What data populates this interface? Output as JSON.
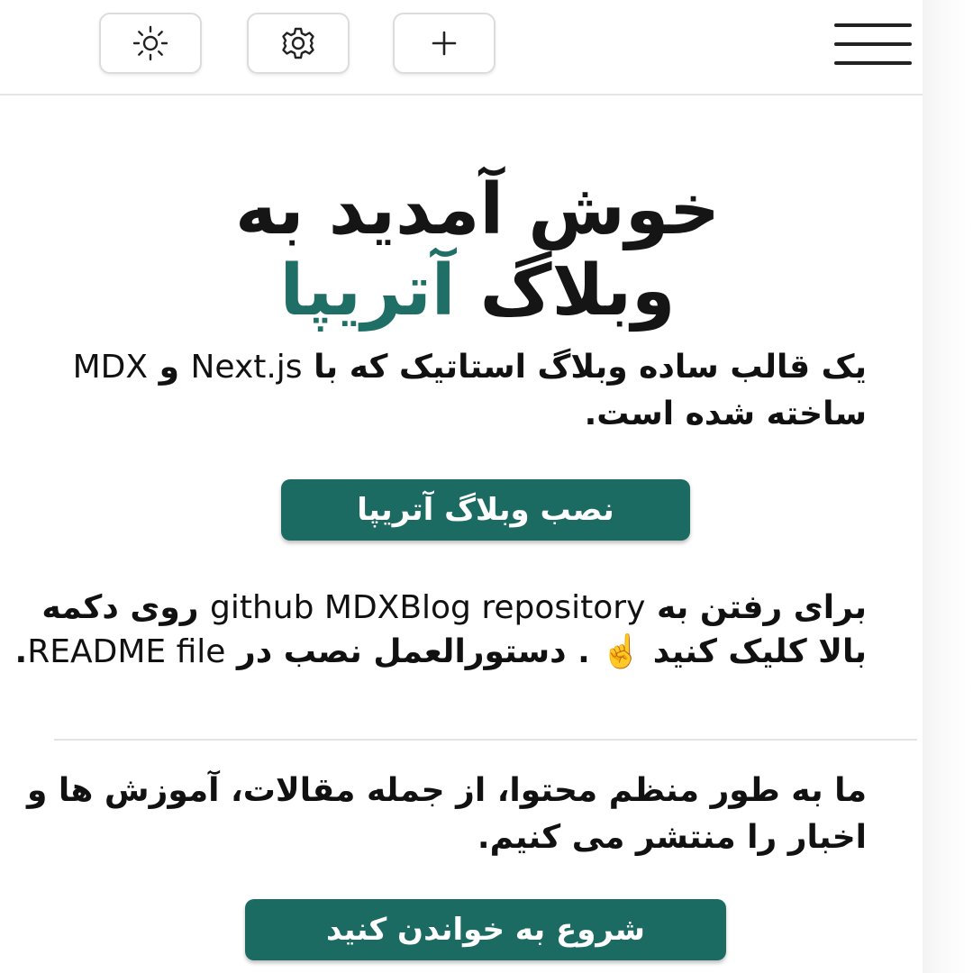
{
  "header": {
    "theme_icon": "sun-icon",
    "settings_icon": "gear-icon",
    "add_label": "+",
    "menu_icon": "hamburger-menu-icon"
  },
  "hero": {
    "title_line1": "خوش آمدید به",
    "title_line2_prefix": "وبلاگ",
    "title_line2_accent": "آتریپا",
    "accent_color": "#1f6f66"
  },
  "intro": {
    "part1": "یک قالب ساده وبلاگ استاتیک که با",
    "framework": "Next.js",
    "part2": "و",
    "format": "MDX",
    "part3": "ساخته شده است."
  },
  "install_button": {
    "label": "نصب وبلاگ آتریپا",
    "color": "#1c6b63"
  },
  "repo": {
    "part1": "برای رفتن به",
    "repo_name": "github MDXBlog repository",
    "part2": "روی دکمه بالا کلیک کنید",
    "pointer_emoji": "☝️",
    "part3": ". دستورالعمل نصب در",
    "readme": "README file",
    "end": "."
  },
  "mission": {
    "text": "ما به طور منظم محتوا، از جمله مقالات، آموزش ها و اخبار را منتشر می کنیم."
  },
  "read_button": {
    "label": "شروع به خواندن کنید",
    "color": "#1c6b63"
  }
}
